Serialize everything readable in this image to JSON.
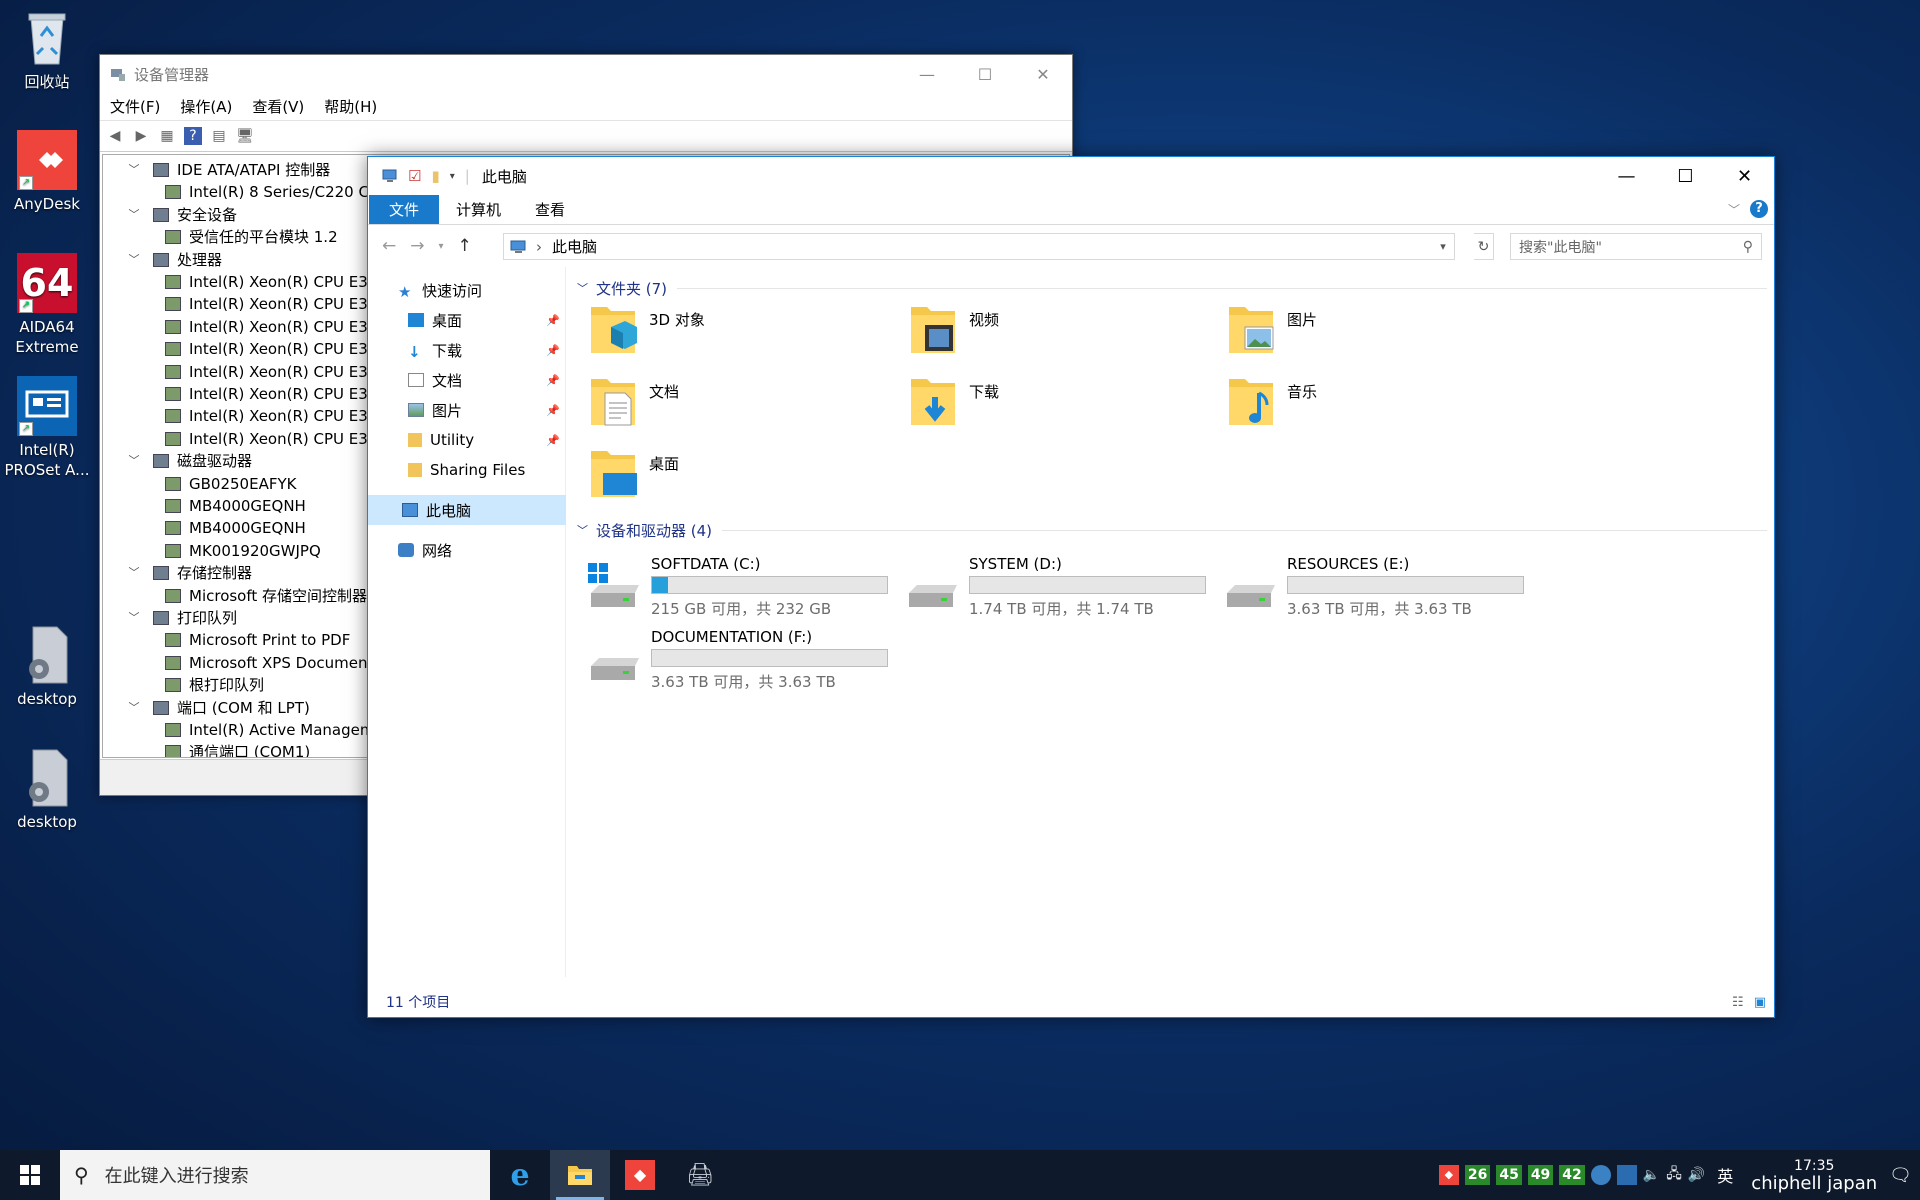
{
  "desktop": {
    "icons": [
      {
        "label": "回收站"
      },
      {
        "label": "AnyDesk"
      },
      {
        "label": "AIDA64\nExtreme",
        "line1": "AIDA64",
        "line2": "Extreme",
        "tile_text": "64"
      },
      {
        "label": "Intel(R) PROSet A...",
        "line1": "Intel(R)",
        "line2": "PROSet A..."
      },
      {
        "label": "desktop"
      },
      {
        "label": "desktop"
      }
    ]
  },
  "device_manager": {
    "title": "设备管理器",
    "menu": [
      "文件(F)",
      "操作(A)",
      "查看(V)",
      "帮助(H)"
    ],
    "tree": [
      {
        "text": "IDE ATA/ATAPI 控制器",
        "level": 1,
        "expanded": true
      },
      {
        "text": "Intel(R) 8 Series/C220 C",
        "level": 2
      },
      {
        "text": "安全设备",
        "level": 1,
        "expanded": true
      },
      {
        "text": "受信任的平台模块 1.2",
        "level": 2
      },
      {
        "text": "处理器",
        "level": 1,
        "expanded": true
      },
      {
        "text": "Intel(R) Xeon(R) CPU E3",
        "level": 2
      },
      {
        "text": "Intel(R) Xeon(R) CPU E3",
        "level": 2
      },
      {
        "text": "Intel(R) Xeon(R) CPU E3",
        "level": 2
      },
      {
        "text": "Intel(R) Xeon(R) CPU E3",
        "level": 2
      },
      {
        "text": "Intel(R) Xeon(R) CPU E3",
        "level": 2
      },
      {
        "text": "Intel(R) Xeon(R) CPU E3",
        "level": 2
      },
      {
        "text": "Intel(R) Xeon(R) CPU E3",
        "level": 2
      },
      {
        "text": "Intel(R) Xeon(R) CPU E3",
        "level": 2
      },
      {
        "text": "磁盘驱动器",
        "level": 1,
        "expanded": true
      },
      {
        "text": "GB0250EAFYK",
        "level": 2
      },
      {
        "text": "MB4000GEQNH",
        "level": 2
      },
      {
        "text": "MB4000GEQNH",
        "level": 2
      },
      {
        "text": "MK001920GWJPQ",
        "level": 2
      },
      {
        "text": "存储控制器",
        "level": 1,
        "expanded": true
      },
      {
        "text": "Microsoft 存储空间控制器",
        "level": 2
      },
      {
        "text": "打印队列",
        "level": 1,
        "expanded": true
      },
      {
        "text": "Microsoft Print to PDF",
        "level": 2
      },
      {
        "text": "Microsoft XPS Documen",
        "level": 2
      },
      {
        "text": "根打印队列",
        "level": 2
      },
      {
        "text": "端口 (COM 和 LPT)",
        "level": 1,
        "expanded": true
      },
      {
        "text": "Intel(R) Active Managem",
        "level": 2
      },
      {
        "text": "通信端口 (COM1)",
        "level": 2
      }
    ]
  },
  "explorer": {
    "title": "此电脑",
    "tabs": {
      "file": "文件",
      "computer": "计算机",
      "view": "查看"
    },
    "address": "此电脑",
    "search_placeholder": "搜索\"此电脑\"",
    "nav": {
      "quick_access": "快速访问",
      "items": [
        {
          "label": "桌面",
          "pinned": true
        },
        {
          "label": "下载",
          "pinned": true
        },
        {
          "label": "文档",
          "pinned": true
        },
        {
          "label": "图片",
          "pinned": true
        },
        {
          "label": "Utility",
          "pinned": true
        },
        {
          "label": "Sharing Files",
          "pinned": false
        }
      ],
      "this_pc": "此电脑",
      "network": "网络"
    },
    "folders_header": "文件夹 (7)",
    "folders": [
      {
        "name": "3D 对象",
        "icon": "3d-objects-folder-icon"
      },
      {
        "name": "视频",
        "icon": "videos-folder-icon"
      },
      {
        "name": "图片",
        "icon": "pictures-folder-icon"
      },
      {
        "name": "文档",
        "icon": "documents-folder-icon"
      },
      {
        "name": "下载",
        "icon": "downloads-folder-icon"
      },
      {
        "name": "音乐",
        "icon": "music-folder-icon"
      },
      {
        "name": "桌面",
        "icon": "desktop-folder-icon"
      }
    ],
    "drives_header": "设备和驱动器 (4)",
    "drives": [
      {
        "name": "SOFTDATA (C:)",
        "free_text": "215 GB 可用，共 232 GB",
        "used_fraction": 0.07,
        "system": true
      },
      {
        "name": "SYSTEM (D:)",
        "free_text": "1.74 TB 可用，共 1.74 TB",
        "used_fraction": 0.0
      },
      {
        "name": "RESOURCES (E:)",
        "free_text": "3.63 TB 可用，共 3.63 TB",
        "used_fraction": 0.0
      },
      {
        "name": "DOCUMENTATION (F:)",
        "free_text": "3.63 TB 可用，共 3.63 TB",
        "used_fraction": 0.0
      }
    ],
    "status": "11 个项目"
  },
  "taskbar": {
    "search_placeholder": "在此键入进行搜索",
    "tray_badges": [
      "26",
      "45",
      "49",
      "42"
    ],
    "ime": "英",
    "time": "17:35",
    "date_overlay": "chiphell japan"
  },
  "colors": {
    "accent": "#1979ca",
    "progress": "#26a0da",
    "group_header": "#1e3287",
    "selection": "#cce8ff"
  }
}
